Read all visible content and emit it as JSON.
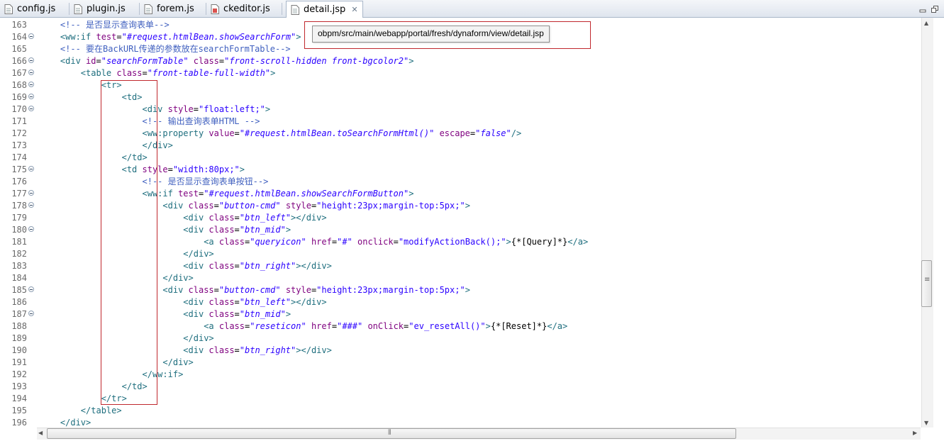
{
  "tabs": [
    {
      "label": "config.js",
      "active": false
    },
    {
      "label": "plugin.js",
      "active": false
    },
    {
      "label": "forem.js",
      "active": false
    },
    {
      "label": "ckeditor.js",
      "active": false
    },
    {
      "label": "detail.jsp",
      "active": true
    }
  ],
  "tab_close_glyph": "✕",
  "window_buttons": [
    "minimize",
    "maximize"
  ],
  "tooltip": "obpm/src/main/webapp/portal/fresh/dynaform/view/detail.jsp",
  "colors": {
    "comment": "#3f5fbf",
    "tag": "#1e6e7e",
    "attribute": "#7f007f",
    "attribute_value": "#2a00ff",
    "annotation_box": "#c0282d"
  },
  "icons": {
    "tab_file": "js-file-icon",
    "tab_jsp": "jsp-file-icon",
    "fold": "fold-minus-icon"
  },
  "editor": {
    "lines": [
      {
        "num": "163",
        "fold": false,
        "indent": "    ",
        "parts": [
          [
            "c",
            "<!-- 是否显示查询表单-->"
          ]
        ]
      },
      {
        "num": "164",
        "fold": true,
        "indent": "    ",
        "parts": [
          [
            "t",
            "<ww:if "
          ],
          [
            "a",
            "test"
          ],
          [
            "p",
            "="
          ],
          [
            "v",
            "\"#request.htmlBean.showSearchForm\""
          ],
          [
            "t",
            ">"
          ]
        ]
      },
      {
        "num": "165",
        "fold": false,
        "indent": "    ",
        "parts": [
          [
            "c",
            "<!-- 要在BackURL传递的参数放在searchFormTable-->"
          ]
        ]
      },
      {
        "num": "166",
        "fold": true,
        "indent": "    ",
        "parts": [
          [
            "t",
            "<div "
          ],
          [
            "a",
            "id"
          ],
          [
            "p",
            "="
          ],
          [
            "v",
            "\"searchFormTable\""
          ],
          [
            "t",
            " "
          ],
          [
            "a",
            "class"
          ],
          [
            "p",
            "="
          ],
          [
            "v",
            "\"front-scroll-hidden front-bgcolor2\""
          ],
          [
            "t",
            ">"
          ]
        ]
      },
      {
        "num": "167",
        "fold": true,
        "indent": "        ",
        "parts": [
          [
            "t",
            "<table "
          ],
          [
            "a",
            "class"
          ],
          [
            "p",
            "="
          ],
          [
            "v",
            "\"front-table-full-width\""
          ],
          [
            "t",
            ">"
          ]
        ]
      },
      {
        "num": "168",
        "fold": true,
        "indent": "            ",
        "parts": [
          [
            "t",
            "<tr>"
          ]
        ]
      },
      {
        "num": "169",
        "fold": true,
        "indent": "                ",
        "parts": [
          [
            "t",
            "<td>"
          ]
        ]
      },
      {
        "num": "170",
        "fold": true,
        "indent": "                    ",
        "parts": [
          [
            "t",
            "<div "
          ],
          [
            "a",
            "style"
          ],
          [
            "p",
            "="
          ],
          [
            "vn",
            "\"float:left;\""
          ],
          [
            "t",
            ">"
          ]
        ]
      },
      {
        "num": "171",
        "fold": false,
        "indent": "                    ",
        "parts": [
          [
            "c",
            "<!-- 输出查询表单HTML -->"
          ]
        ]
      },
      {
        "num": "172",
        "fold": false,
        "indent": "                    ",
        "parts": [
          [
            "t",
            "<ww:property "
          ],
          [
            "a",
            "value"
          ],
          [
            "p",
            "="
          ],
          [
            "v",
            "\"#request.htmlBean.toSearchFormHtml()\""
          ],
          [
            "t",
            " "
          ],
          [
            "a",
            "escape"
          ],
          [
            "p",
            "="
          ],
          [
            "v",
            "\"false\""
          ],
          [
            "t",
            "/>"
          ]
        ]
      },
      {
        "num": "173",
        "fold": false,
        "indent": "                    ",
        "parts": [
          [
            "t",
            "</div>"
          ]
        ]
      },
      {
        "num": "174",
        "fold": false,
        "indent": "                ",
        "parts": [
          [
            "t",
            "</td>"
          ]
        ]
      },
      {
        "num": "175",
        "fold": true,
        "indent": "                ",
        "parts": [
          [
            "t",
            "<td "
          ],
          [
            "a",
            "style"
          ],
          [
            "p",
            "="
          ],
          [
            "vn",
            "\"width:80px;\""
          ],
          [
            "t",
            ">"
          ]
        ]
      },
      {
        "num": "176",
        "fold": false,
        "indent": "                    ",
        "parts": [
          [
            "c",
            "<!-- 是否显示查询表单按钮-->"
          ]
        ]
      },
      {
        "num": "177",
        "fold": true,
        "indent": "                    ",
        "parts": [
          [
            "t",
            "<ww:if "
          ],
          [
            "a",
            "test"
          ],
          [
            "p",
            "="
          ],
          [
            "v",
            "\"#request.htmlBean.showSearchFormButton\""
          ],
          [
            "t",
            ">"
          ]
        ]
      },
      {
        "num": "178",
        "fold": true,
        "indent": "                        ",
        "parts": [
          [
            "t",
            "<div "
          ],
          [
            "a",
            "class"
          ],
          [
            "p",
            "="
          ],
          [
            "v",
            "\"button-cmd\""
          ],
          [
            "t",
            " "
          ],
          [
            "a",
            "style"
          ],
          [
            "p",
            "="
          ],
          [
            "vn",
            "\"height:23px;margin-top:5px;\""
          ],
          [
            "t",
            ">"
          ]
        ]
      },
      {
        "num": "179",
        "fold": false,
        "indent": "                            ",
        "parts": [
          [
            "t",
            "<div "
          ],
          [
            "a",
            "class"
          ],
          [
            "p",
            "="
          ],
          [
            "v",
            "\"btn_left\""
          ],
          [
            "t",
            "></div>"
          ]
        ]
      },
      {
        "num": "180",
        "fold": true,
        "indent": "                            ",
        "parts": [
          [
            "t",
            "<div "
          ],
          [
            "a",
            "class"
          ],
          [
            "p",
            "="
          ],
          [
            "v",
            "\"btn_mid\""
          ],
          [
            "t",
            ">"
          ]
        ]
      },
      {
        "num": "181",
        "fold": false,
        "indent": "                                ",
        "parts": [
          [
            "t",
            "<a "
          ],
          [
            "a",
            "class"
          ],
          [
            "p",
            "="
          ],
          [
            "v",
            "\"queryicon\""
          ],
          [
            "t",
            " "
          ],
          [
            "a",
            "href"
          ],
          [
            "p",
            "="
          ],
          [
            "vn",
            "\"#\""
          ],
          [
            "t",
            " "
          ],
          [
            "a",
            "onclick"
          ],
          [
            "p",
            "="
          ],
          [
            "vn",
            "\"modifyActionBack();\""
          ],
          [
            "t",
            ">"
          ],
          [
            "p",
            "{*[Query]*}"
          ],
          [
            "t",
            "</a>"
          ]
        ]
      },
      {
        "num": "182",
        "fold": false,
        "indent": "                            ",
        "parts": [
          [
            "t",
            "</div>"
          ]
        ]
      },
      {
        "num": "183",
        "fold": false,
        "indent": "                            ",
        "parts": [
          [
            "t",
            "<div "
          ],
          [
            "a",
            "class"
          ],
          [
            "p",
            "="
          ],
          [
            "v",
            "\"btn_right\""
          ],
          [
            "t",
            "></div>"
          ]
        ]
      },
      {
        "num": "184",
        "fold": false,
        "indent": "                        ",
        "parts": [
          [
            "t",
            "</div>"
          ]
        ]
      },
      {
        "num": "185",
        "fold": true,
        "indent": "                        ",
        "parts": [
          [
            "t",
            "<div "
          ],
          [
            "a",
            "class"
          ],
          [
            "p",
            "="
          ],
          [
            "v",
            "\"button-cmd\""
          ],
          [
            "t",
            " "
          ],
          [
            "a",
            "style"
          ],
          [
            "p",
            "="
          ],
          [
            "vn",
            "\"height:23px;margin-top:5px;\""
          ],
          [
            "t",
            ">"
          ]
        ]
      },
      {
        "num": "186",
        "fold": false,
        "indent": "                            ",
        "parts": [
          [
            "t",
            "<div "
          ],
          [
            "a",
            "class"
          ],
          [
            "p",
            "="
          ],
          [
            "v",
            "\"btn_left\""
          ],
          [
            "t",
            "></div>"
          ]
        ]
      },
      {
        "num": "187",
        "fold": true,
        "indent": "                            ",
        "parts": [
          [
            "t",
            "<div "
          ],
          [
            "a",
            "class"
          ],
          [
            "p",
            "="
          ],
          [
            "v",
            "\"btn_mid\""
          ],
          [
            "t",
            ">"
          ]
        ]
      },
      {
        "num": "188",
        "fold": false,
        "indent": "                                ",
        "parts": [
          [
            "t",
            "<a "
          ],
          [
            "a",
            "class"
          ],
          [
            "p",
            "="
          ],
          [
            "v",
            "\"reseticon\""
          ],
          [
            "t",
            " "
          ],
          [
            "a",
            "href"
          ],
          [
            "p",
            "="
          ],
          [
            "vn",
            "\"###\""
          ],
          [
            "t",
            " "
          ],
          [
            "a",
            "onClick"
          ],
          [
            "p",
            "="
          ],
          [
            "vn",
            "\"ev_resetAll()\""
          ],
          [
            "t",
            ">"
          ],
          [
            "p",
            "{*[Reset]*}"
          ],
          [
            "t",
            "</a>"
          ]
        ]
      },
      {
        "num": "189",
        "fold": false,
        "indent": "                            ",
        "parts": [
          [
            "t",
            "</div>"
          ]
        ]
      },
      {
        "num": "190",
        "fold": false,
        "indent": "                            ",
        "parts": [
          [
            "t",
            "<div "
          ],
          [
            "a",
            "class"
          ],
          [
            "p",
            "="
          ],
          [
            "v",
            "\"btn_right\""
          ],
          [
            "t",
            "></div>"
          ]
        ]
      },
      {
        "num": "191",
        "fold": false,
        "indent": "                        ",
        "parts": [
          [
            "t",
            "</div>"
          ]
        ]
      },
      {
        "num": "192",
        "fold": false,
        "indent": "                    ",
        "parts": [
          [
            "t",
            "</ww:if>"
          ]
        ]
      },
      {
        "num": "193",
        "fold": false,
        "indent": "                ",
        "parts": [
          [
            "t",
            "</td>"
          ]
        ]
      },
      {
        "num": "194",
        "fold": false,
        "indent": "            ",
        "parts": [
          [
            "t",
            "</tr>"
          ]
        ]
      },
      {
        "num": "195",
        "fold": false,
        "indent": "        ",
        "parts": [
          [
            "t",
            "</table>"
          ]
        ]
      },
      {
        "num": "196",
        "fold": false,
        "indent": "    ",
        "parts": [
          [
            "t",
            "</div>"
          ]
        ]
      }
    ]
  }
}
